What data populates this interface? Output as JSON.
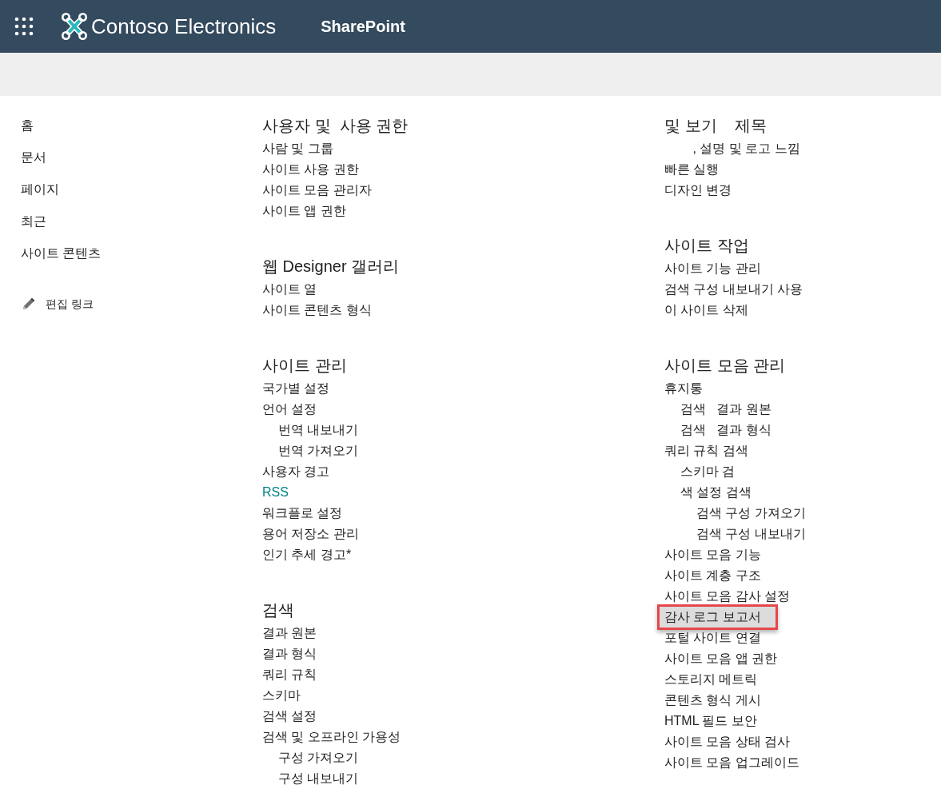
{
  "header": {
    "site_title": "Contoso Electronics",
    "app_name": "SharePoint"
  },
  "left_nav": {
    "items": [
      {
        "label": "홈"
      },
      {
        "label": "문서"
      },
      {
        "label": "페이지"
      },
      {
        "label": "최근"
      },
      {
        "label": "사이트 콘텐츠"
      }
    ],
    "edit_links": "편집 링크"
  },
  "columns": [
    {
      "sections": [
        {
          "heading": "사용자 및  사용 권한",
          "items": [
            {
              "label": "사람 및 그룹"
            },
            {
              "label": "사이트 사용 권한"
            },
            {
              "label": "사이트 모음 관리자"
            },
            {
              "label": "사이트 앱 권한"
            }
          ]
        },
        {
          "heading": "웹 Designer 갤러리",
          "items": [
            {
              "label": "사이트 열"
            },
            {
              "label": "사이트 콘텐츠 형식"
            }
          ]
        },
        {
          "heading": "사이트 관리",
          "items": [
            {
              "label": "국가별 설정"
            },
            {
              "label": "언어 설정",
              "children": [
                {
                  "label": "번역 내보내기"
                },
                {
                  "label": "번역 가져오기"
                }
              ]
            },
            {
              "label": "사용자 경고"
            },
            {
              "label": "RSS",
              "color": "#038387"
            },
            {
              "label": "워크플로 설정"
            },
            {
              "label": "용어 저장소 관리"
            },
            {
              "label": "인기 추세 경고*"
            }
          ]
        },
        {
          "heading": "검색",
          "items": [
            {
              "label": "결과 원본"
            },
            {
              "label": "결과 형식"
            },
            {
              "label": "쿼리 규칙"
            },
            {
              "label": "스키마"
            },
            {
              "label": "검색 설정"
            },
            {
              "label": "검색 및 오프라인 가용성",
              "children": [
                {
                  "label": "구성 가져오기"
                },
                {
                  "label": "구성 내보내기"
                }
              ]
            }
          ]
        }
      ]
    },
    {
      "sections": [
        {
          "heading": "및 보기    제목",
          "items": [
            {
              "label": "        , 설명 및 로고 느낌"
            },
            {
              "label": "빠른 실행"
            },
            {
              "label": "디자인 변경"
            }
          ]
        },
        {
          "heading": "사이트 작업",
          "items": [
            {
              "label": "사이트 기능 관리"
            },
            {
              "label": "검색 구성 내보내기 사용"
            },
            {
              "label": "이 사이트 삭제"
            }
          ]
        },
        {
          "heading": "사이트 모음 관리",
          "items": [
            {
              "label": "휴지통",
              "highlighted": false,
              "children": [
                {
                  "label": "검색   결과 원본",
                  "highlighted": false
                },
                {
                  "label": "검색   결과 형식",
                  "highlighted": false
                }
              ]
            },
            {
              "label": "쿼리 규칙 검색",
              "highlighted": false,
              "children": [
                {
                  "label": "스키마 검",
                  "highlighted": false
                },
                {
                  "label": "색 설정 검색",
                  "highlighted": false,
                  "children": [
                    {
                      "label": "검색 구성 가져오기",
                      "highlighted": false
                    },
                    {
                      "label": "검색 구성 내보내기",
                      "highlighted": false
                    }
                  ]
                }
              ]
            },
            {
              "label": "사이트 모음 기능",
              "highlighted": false
            },
            {
              "label": "사이트 계층 구조",
              "highlighted": false
            },
            {
              "label": "사이트 모음 감사 설정",
              "highlighted": false
            },
            {
              "label": "감사 로그 보고서",
              "highlighted": true
            },
            {
              "label": "포털 사이트 연결",
              "highlighted": false
            },
            {
              "label": "사이트 모음 앱 권한",
              "highlighted": false
            },
            {
              "label": "스토리지 메트릭",
              "highlighted": false
            },
            {
              "label": "콘텐츠 형식 게시",
              "highlighted": false
            },
            {
              "label": "HTML 필드 보안",
              "highlighted": false
            },
            {
              "label": "사이트 모음 상태 검사",
              "highlighted": false
            },
            {
              "label": "사이트 모음 업그레이드",
              "highlighted": false
            }
          ]
        }
      ]
    }
  ]
}
